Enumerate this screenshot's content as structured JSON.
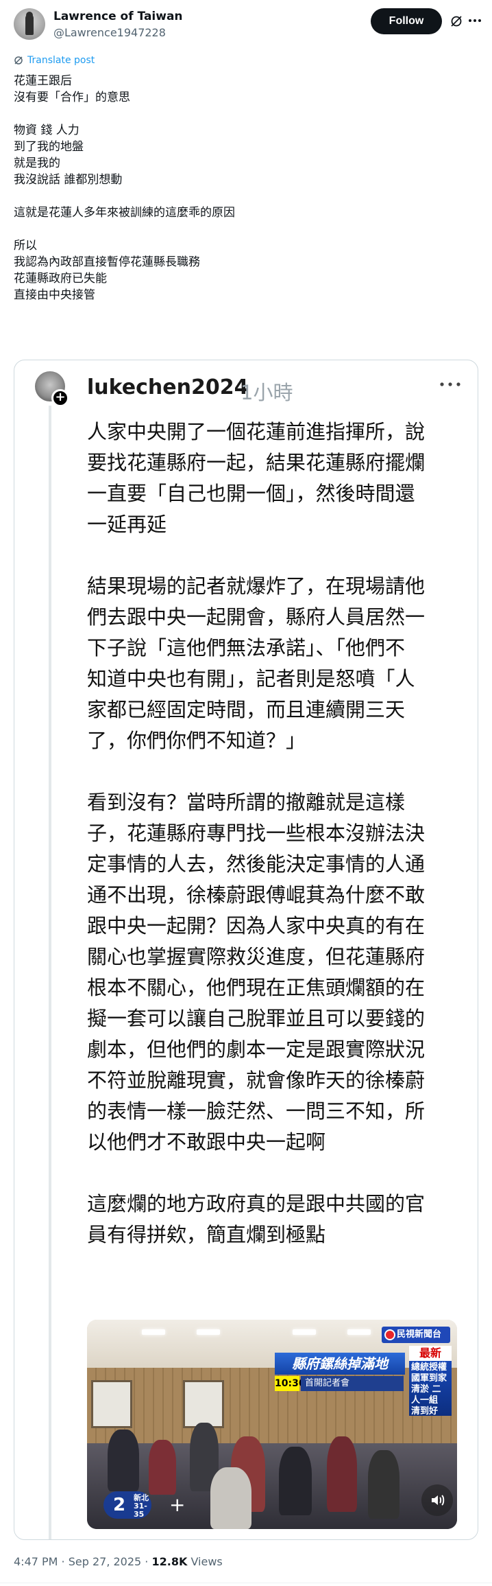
{
  "author": {
    "display_name": "Lawrence of Taiwan",
    "handle": "@Lawrence1947228",
    "follow_label": "Follow"
  },
  "post": {
    "translate_label": "Translate post",
    "lines": [
      "花蓮王跟后",
      "沒有要「合作」的意思",
      "",
      "物資 錢 人力",
      "到了我的地盤",
      "就是我的",
      "我沒說話 誰都別想動",
      "",
      "這就是花蓮人多年來被訓練的這麼乖的原因",
      "",
      "所以",
      "我認為內政部直接暫停花蓮縣長職務",
      "花蓮縣政府已失能",
      "直接由中央接管"
    ]
  },
  "quoted": {
    "username": "lukechen2024",
    "time": "1小時",
    "lines": [
      "人家中央開了一個花蓮前進指揮所，說",
      "要找花蓮縣府一起，結果花蓮縣府擺爛",
      "一直要「自己也開一個」，然後時間還",
      "一延再延",
      "",
      "結果現場的記者就爆炸了，在現場請他",
      "們去跟中央一起開會，縣府人員居然一",
      "下子說「這他們無法承諾」、「他們不",
      "知道中央也有開」，記者則是怒噴「人",
      "家都已經固定時間，而且連續開三天",
      "了，你們你們不知道？」",
      "",
      "看到沒有？當時所謂的撤離就是這樣",
      "子，花蓮縣府專門找一些根本沒辦法決",
      "定事情的人去，然後能決定事情的人通",
      "通不出現，徐榛蔚跟傅崐萁為什麼不敢",
      "跟中央一起開？因為人家中央真的有在",
      "關心也掌握實際救災進度，但花蓮縣府",
      "根本不關心，他們現在正焦頭爛額的在",
      "擬一套可以讓自己脫罪並且可以要錢的",
      "劇本，但他們的劇本一定是跟實際狀況",
      "不符並脫離現實，就會像昨天的徐榛蔚",
      "的表情一樣一臉茫然、一問三不知，所",
      "以他們才不敢跟中央一起啊",
      "",
      "這麼爛的地方政府真的是跟中共國的官",
      "員有得拼欸，簡直爛到極點"
    ],
    "media": {
      "logo": "民視新聞台",
      "headline": "縣府鏍絲掉滿地",
      "time_tag": "10:30",
      "subheadline": "首開記者會",
      "latest_tag": "最新",
      "latest_text": "總統授權國軍到家清淤 二人一組 清到好",
      "channel_number": "2",
      "channel_region": "新北",
      "channel_temp": "31-35"
    }
  },
  "footer": {
    "time": "4:47 PM · Sep 27, 2025 · ",
    "views_count": "12.8K",
    "views_label": " Views"
  }
}
